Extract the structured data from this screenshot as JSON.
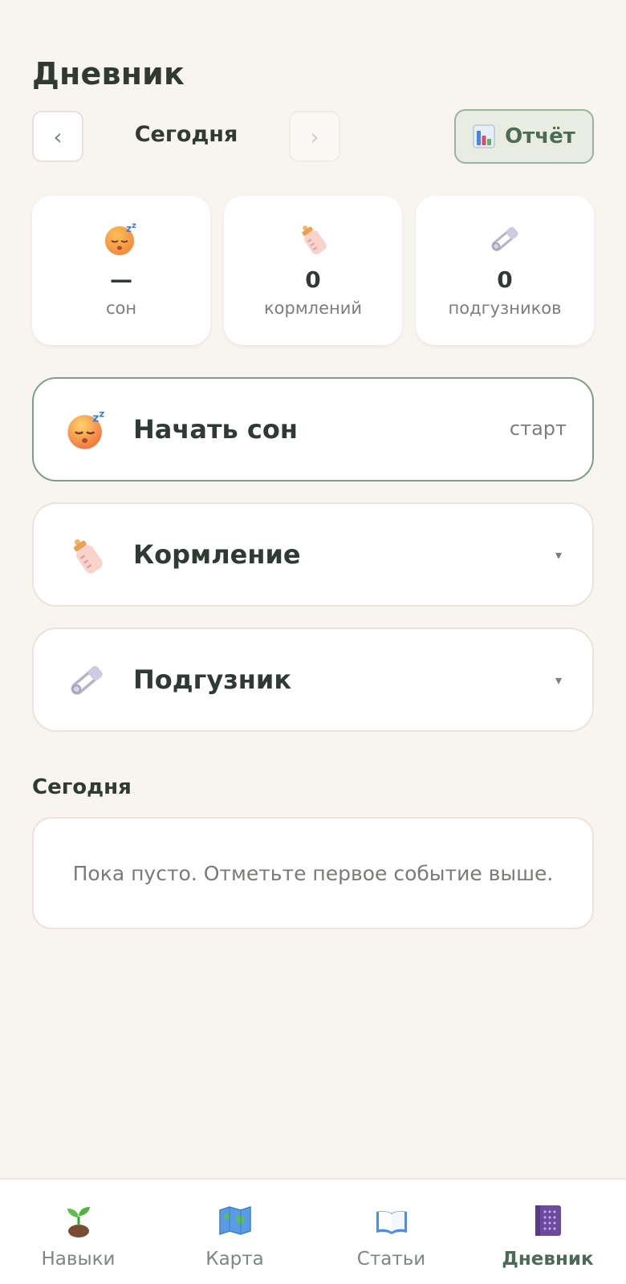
{
  "header": {
    "title": "Дневник"
  },
  "date_nav": {
    "prev_icon": "chevron-left-icon",
    "prev_glyph": "‹",
    "label": "Сегодня",
    "next_icon": "chevron-right-icon",
    "next_glyph": "›",
    "report_label": "Отчёт",
    "report_icon": "bar-chart-icon"
  },
  "stats": [
    {
      "icon": "sleeping-face-icon",
      "value": "—",
      "label": "сон"
    },
    {
      "icon": "baby-bottle-icon",
      "value": "0",
      "label": "кормлений"
    },
    {
      "icon": "safety-pin-icon",
      "value": "0",
      "label": "подгузников"
    }
  ],
  "actions": [
    {
      "icon": "sleeping-face-icon",
      "label": "Начать сон",
      "right": "старт"
    },
    {
      "icon": "baby-bottle-icon",
      "label": "Кормление",
      "right": "▾"
    },
    {
      "icon": "safety-pin-icon",
      "label": "Подгузник",
      "right": "▾"
    }
  ],
  "today": {
    "title": "Сегодня",
    "empty_text": "Пока пусто. Отметьте первое событие выше."
  },
  "tabbar": {
    "items": [
      {
        "icon": "seedling-icon",
        "label": "Навыки",
        "active": false
      },
      {
        "icon": "world-map-icon",
        "label": "Карта",
        "active": false
      },
      {
        "icon": "open-book-icon",
        "label": "Статьи",
        "active": false
      },
      {
        "icon": "notebook-icon",
        "label": "Дневник",
        "active": true
      }
    ]
  },
  "colors": {
    "background": "#f8f5f0",
    "accent": "#4b6b55",
    "accent_border": "#7c9f86",
    "text": "#2f3a34",
    "muted": "#7d7d7a"
  }
}
